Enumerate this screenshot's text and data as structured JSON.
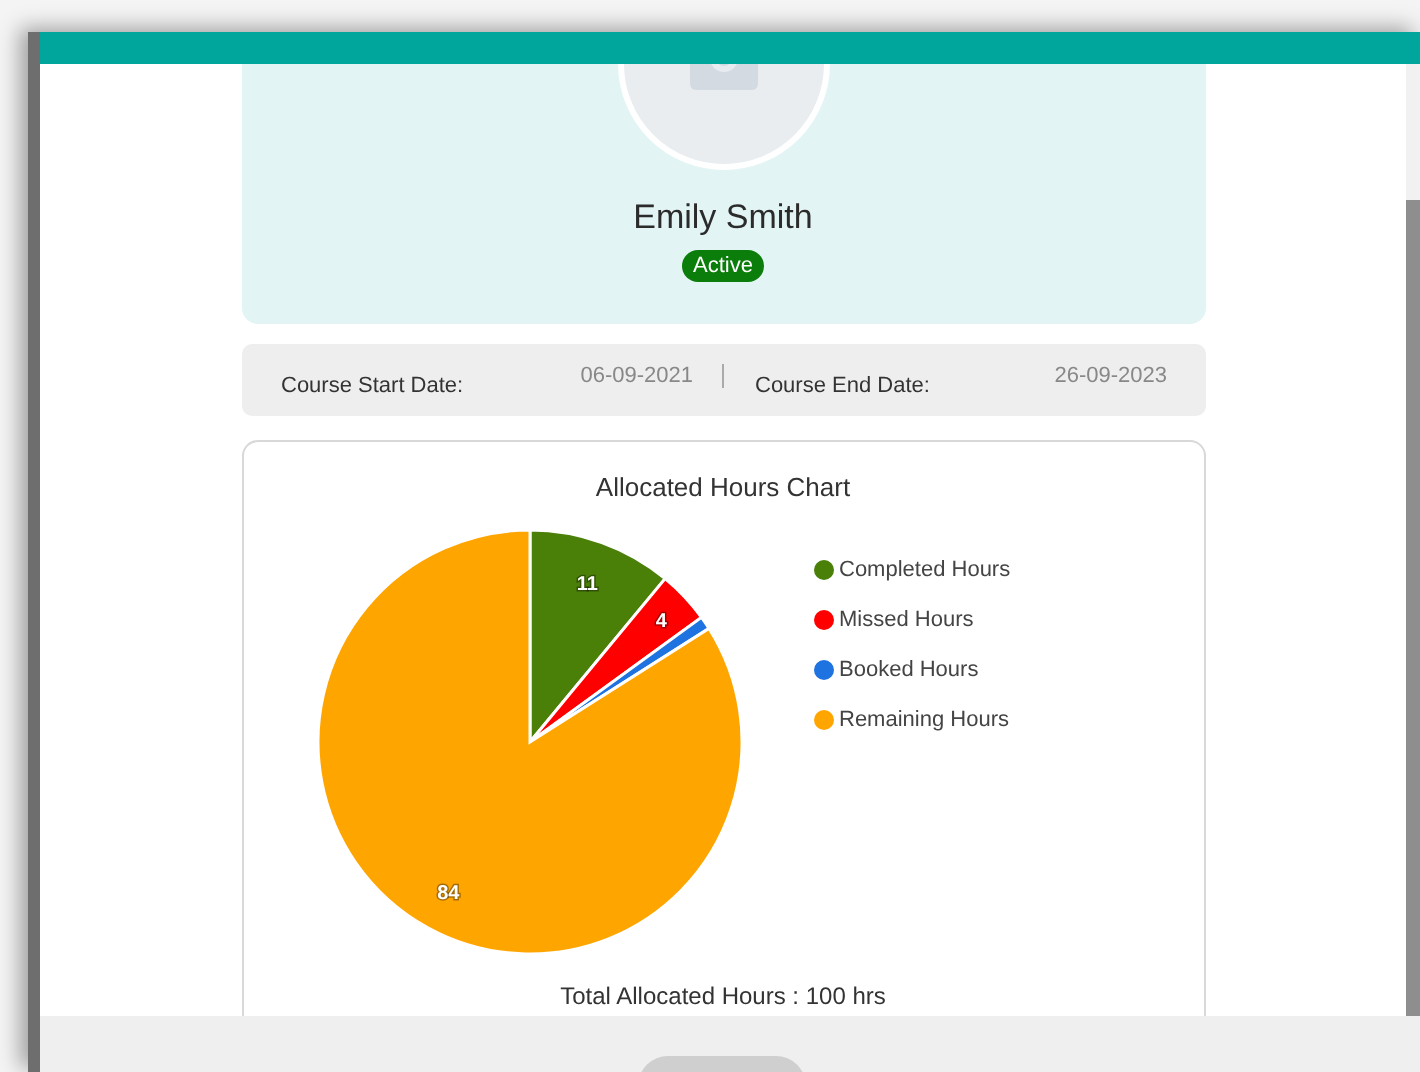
{
  "profile": {
    "name": "Emily Smith",
    "status": "Active"
  },
  "course_dates": [
    {
      "label": "Course Start Date:",
      "value": "06-09-2021"
    },
    {
      "label": "Course End Date:",
      "value": "26-09-2023"
    }
  ],
  "chart": {
    "chart_data": {
      "type": "pie",
      "title": "Allocated Hours Chart",
      "categories": [
        "Completed Hours",
        "Missed Hours",
        "Booked Hours",
        "Remaining Hours"
      ],
      "values": [
        11,
        4,
        1,
        84
      ],
      "legend": "right",
      "colors": [
        "#4a7f08",
        "#ff0000",
        "#1e73e0",
        "#ffa500"
      ],
      "value_labels": [
        "11",
        "4",
        null,
        "84"
      ]
    },
    "total": "Total Allocated Hours : 100 hrs"
  }
}
